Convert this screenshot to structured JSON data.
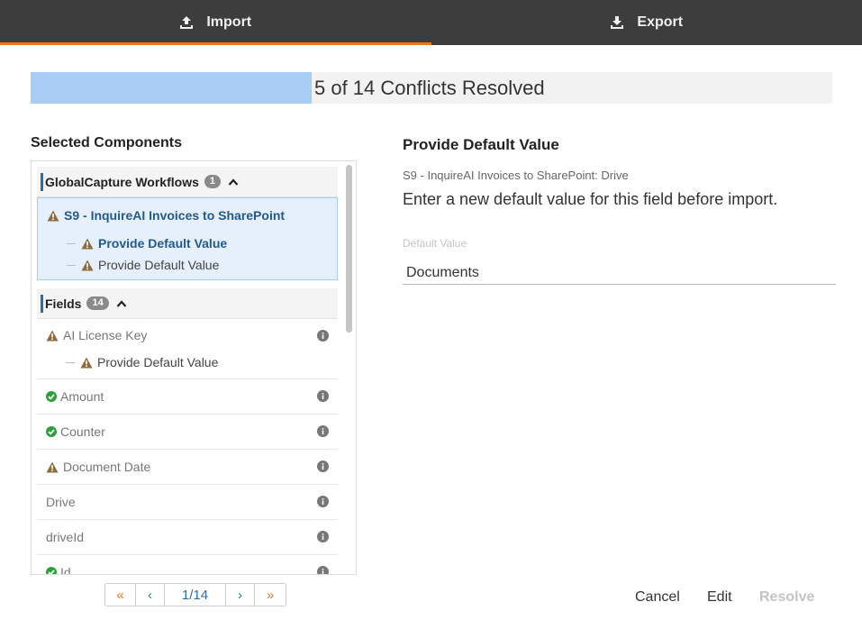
{
  "tabs": {
    "import_label": "Import",
    "export_label": "Export"
  },
  "progress": {
    "text": "5 of 14 Conflicts Resolved",
    "fraction": 0.35
  },
  "left_pane": {
    "title": "Selected Components",
    "group_workflows": {
      "label": "GlobalCapture Workflows",
      "count": "1"
    },
    "selected_item": {
      "label": "S9 - InquireAI Invoices to SharePoint",
      "sub_items": [
        "Provide Default Value",
        "Provide Default Value"
      ]
    },
    "group_fields": {
      "label": "Fields",
      "count": "14"
    },
    "fields": [
      {
        "label": "AI License Key",
        "status": "warning",
        "sub": "Provide Default Value"
      },
      {
        "label": "Amount",
        "status": "resolved"
      },
      {
        "label": "Counter",
        "status": "resolved"
      },
      {
        "label": "Document Date",
        "status": "warning"
      },
      {
        "label": "Drive",
        "status": "none"
      },
      {
        "label": "driveId",
        "status": "none"
      },
      {
        "label": "Id",
        "status": "resolved"
      }
    ]
  },
  "pagination": {
    "first": "«",
    "prev": "‹",
    "page": "1/14",
    "next": "›",
    "last": "»"
  },
  "right_pane": {
    "title": "Provide Default Value",
    "subtitle": "S9 - InquireAI Invoices to SharePoint: Drive",
    "description": "Enter a new default value for this field before import.",
    "field_label": "Default Value",
    "field_value": "Documents"
  },
  "footer": {
    "cancel": "Cancel",
    "edit": "Edit",
    "resolve": "Resolve"
  },
  "colors": {
    "accent": "#e87722",
    "progress_fill": "#a9cdf2",
    "warning": "#8a6d3b",
    "success": "#2e9e3e",
    "link": "#235a8c"
  }
}
